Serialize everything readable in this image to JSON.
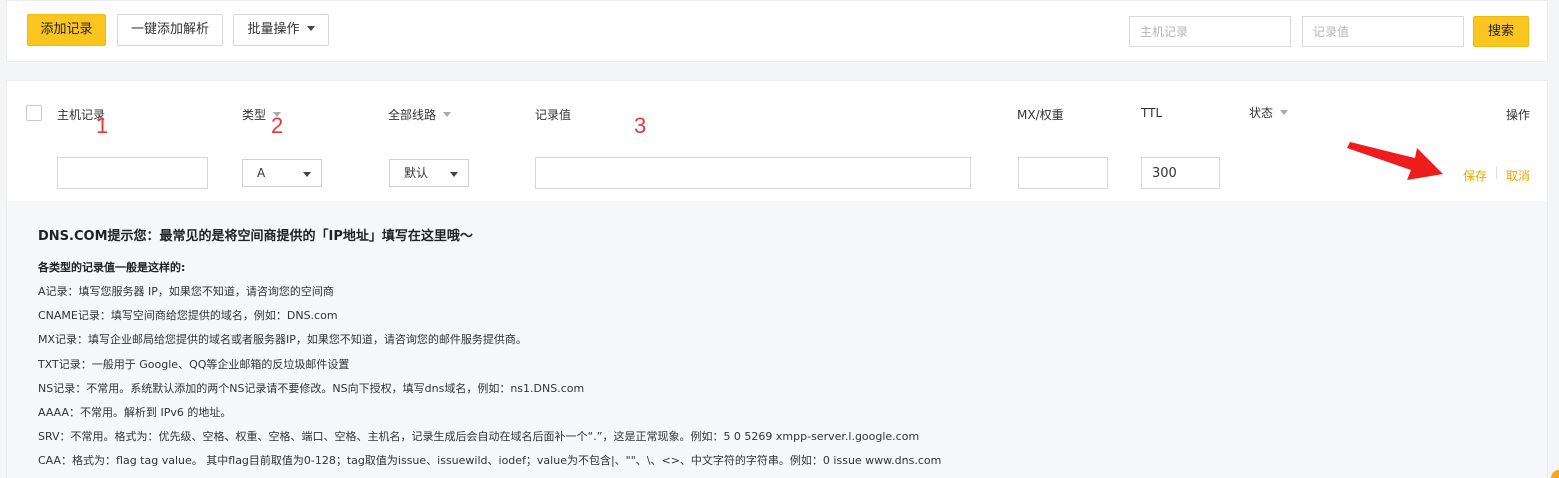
{
  "toolbar": {
    "add_record": "添加记录",
    "one_click_add": "一键添加解析",
    "batch_ops": "批量操作",
    "host_placeholder": "主机记录",
    "value_placeholder": "记录值",
    "search": "搜索"
  },
  "table": {
    "headers": {
      "host": "主机记录",
      "type": "类型",
      "line": "全部线路",
      "value": "记录值",
      "mx": "MX/权重",
      "ttl": "TTL",
      "status": "状态",
      "actions": "操作"
    },
    "annotations": [
      "1",
      "2",
      "3"
    ],
    "edit_row": {
      "host": "",
      "type": "A",
      "line": "默认",
      "value": "",
      "mx": "",
      "ttl": "300",
      "save": "保存",
      "cancel": "取消"
    }
  },
  "tips": {
    "title": "DNS.COM提示您：最常见的是将空间商提供的「IP地址」填写在这里哦～",
    "subtitle": "各类型的记录值一般是这样的:",
    "lines": [
      "A记录：填写您服务器 IP，如果您不知道，请咨询您的空间商",
      "CNAME记录：填写空间商给您提供的域名，例如：DNS.com",
      "MX记录：填写企业邮局给您提供的域名或者服务器IP，如果您不知道，请咨询您的邮件服务提供商。",
      "TXT记录：一般用于 Google、QQ等企业邮箱的反垃圾邮件设置",
      "NS记录：不常用。系统默认添加的两个NS记录请不要修改。NS向下授权，填写dns域名，例如：ns1.DNS.com",
      "AAAA：不常用。解析到 IPv6 的地址。",
      "SRV：不常用。格式为：优先级、空格、权重、空格、端口、空格、主机名，记录生成后会自动在域名后面补一个“.”，这是正常现象。例如：5 0 5269 xmpp-server.l.google.com",
      "CAA：格式为：flag tag value。 其中flag目前取值为0-128；tag取值为issue、issuewild、iodef；value为不包含|、\"\"、\\、<>、中文字符的字符串。例如：0 issue www.dns.com"
    ]
  },
  "colors": {
    "accent": "#f9c51e",
    "link": "#f0a500",
    "annotation": "#e53935"
  }
}
